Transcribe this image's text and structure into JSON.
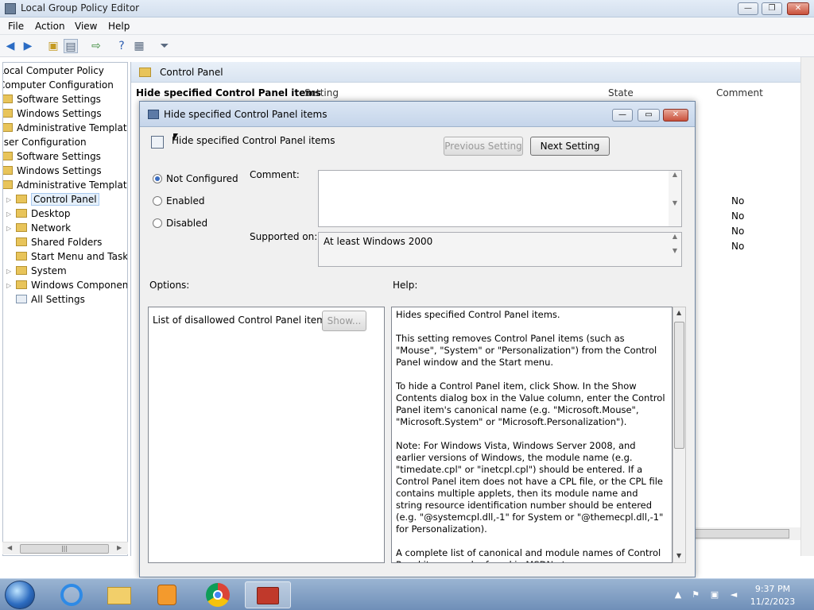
{
  "window": {
    "title": "Local Group Policy Editor",
    "min": "—",
    "max": "❐",
    "close": "✕"
  },
  "menu": [
    "File",
    "Action",
    "View",
    "Help"
  ],
  "tree": {
    "items": [
      {
        "label": "Local Computer Policy",
        "indent": 0
      },
      {
        "label": "Computer Configuration",
        "indent": 0
      },
      {
        "label": "Software Settings",
        "indent": 1
      },
      {
        "label": "Windows Settings",
        "indent": 1
      },
      {
        "label": "Administrative Templates",
        "indent": 1
      },
      {
        "label": "User Configuration",
        "indent": 0
      },
      {
        "label": "Software Settings",
        "indent": 1
      },
      {
        "label": "Windows Settings",
        "indent": 1
      },
      {
        "label": "Administrative Templates",
        "indent": 1
      },
      {
        "label": "Control Panel",
        "indent": 2,
        "selected": true
      },
      {
        "label": "Desktop",
        "indent": 2
      },
      {
        "label": "Network",
        "indent": 2
      },
      {
        "label": "Shared Folders",
        "indent": 2
      },
      {
        "label": "Start Menu and Taskbar",
        "indent": 2
      },
      {
        "label": "System",
        "indent": 2
      },
      {
        "label": "Windows Components",
        "indent": 2
      },
      {
        "label": "All Settings",
        "indent": 2
      }
    ]
  },
  "right_pane": {
    "header": "Control Panel",
    "setting_title": "Hide specified Control Panel items",
    "columns": {
      "setting": "Setting",
      "state": "State",
      "comment": "Comment"
    },
    "states": [
      "No",
      "No",
      "No",
      "No"
    ]
  },
  "dialog": {
    "title": "Hide specified Control Panel items",
    "policy_name": "Hide specified Control Panel items",
    "prev_button": "Previous Setting",
    "next_button": "Next Setting",
    "radios": [
      {
        "label": "Not Configured",
        "checked": true
      },
      {
        "label": "Enabled",
        "checked": false
      },
      {
        "label": "Disabled",
        "checked": false
      }
    ],
    "comment_label": "Comment:",
    "comment_value": "",
    "supported_label": "Supported on:",
    "supported_value": "At least Windows 2000",
    "options_label": "Options:",
    "help_label": "Help:",
    "option_item": "List of disallowed Control Panel items",
    "show_button": "Show...",
    "help_text": "Hides specified Control Panel items.\n\nThis setting removes Control Panel items (such as \"Mouse\", \"System\" or \"Personalization\") from the Control Panel window and the Start menu.\n\nTo hide a Control Panel item, click Show. In the Show Contents dialog box in the Value column, enter the Control Panel item's canonical name (e.g. \"Microsoft.Mouse\", \"Microsoft.System\" or \"Microsoft.Personalization\").\n\nNote: For Windows Vista, Windows Server 2008, and earlier versions of Windows, the module name (e.g. \"timedate.cpl\" or \"inetcpl.cpl\") should be entered. If a Control Panel item does not have a CPL file, or the CPL file contains multiple applets, then its module name and string resource identification number should be entered (e.g. \"@systemcpl.dll,-1\" for System or \"@themecpl.dll,-1\" for Personalization).\n\nA complete list of canonical and module names of Control Panel items can be found in MSDN at"
  },
  "taskbar": {
    "time": "9:37 PM",
    "date": "11/2/2023",
    "icons": [
      "start-orb",
      "internet-explorer-icon",
      "file-explorer-icon",
      "media-player-icon",
      "chrome-icon",
      "group-policy-icon"
    ]
  }
}
